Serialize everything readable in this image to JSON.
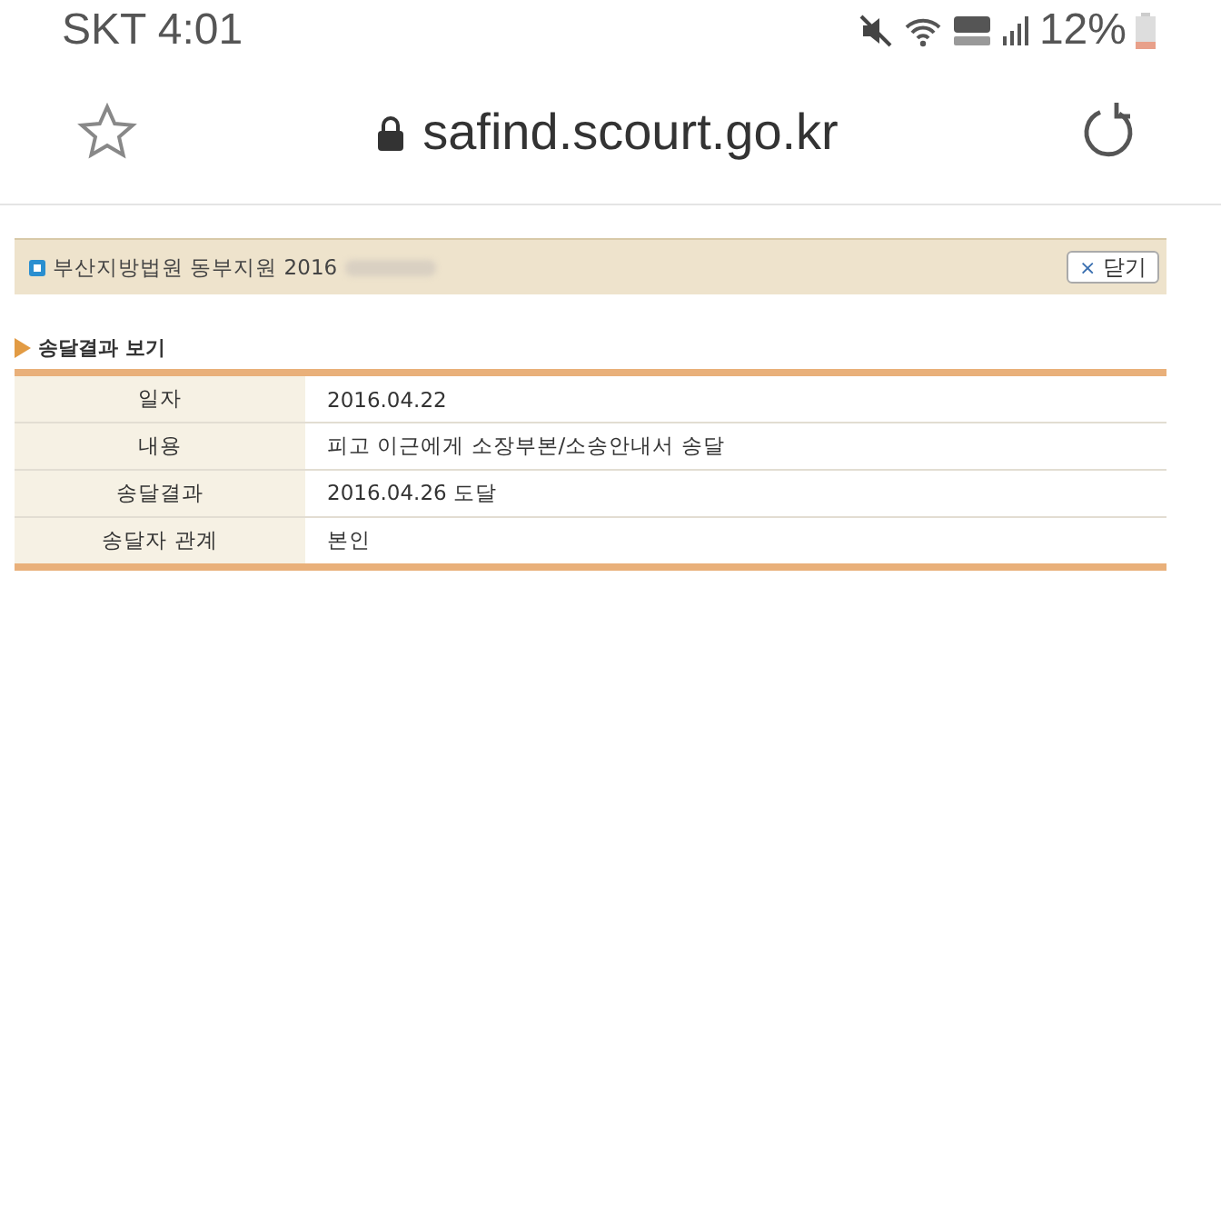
{
  "status_bar": {
    "carrier_time": "SKT 4:01",
    "battery": "12%"
  },
  "address_bar": {
    "url": "safind.scourt.go.kr"
  },
  "case_header": {
    "title": "부산지방법원 동부지원  2016",
    "close_button": "닫기",
    "close_glyph": "×"
  },
  "section": {
    "title": "송달결과 보기"
  },
  "table": {
    "rows": [
      {
        "label": "일자",
        "value": "2016.04.22"
      },
      {
        "label": "내용",
        "value": "피고 이근에게 소장부본/소송안내서 송달"
      },
      {
        "label": "송달결과",
        "value": "2016.04.26 도달"
      },
      {
        "label": "송달자 관계",
        "value": "본인"
      }
    ]
  }
}
